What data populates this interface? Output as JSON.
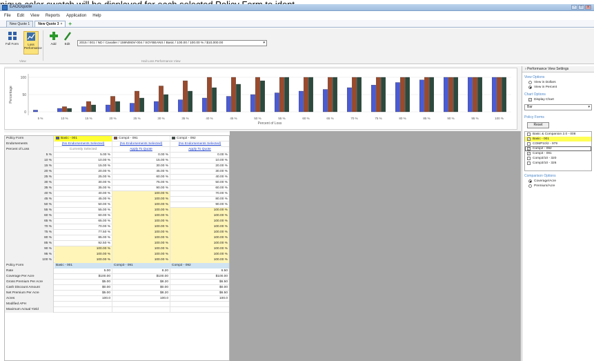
{
  "caption_text": "nique color swatch will be displayed for each selected Policy Form to ident",
  "window": {
    "title": "EAOOquote",
    "buttons": [
      "-",
      "□",
      "x"
    ]
  },
  "menu": [
    "File",
    "Edit",
    "View",
    "Reports",
    "Application",
    "Help"
  ],
  "tabs": [
    {
      "label": "New Quote 1",
      "active": false
    },
    {
      "label": "New Quote 3",
      "active": true,
      "close": "×"
    }
  ],
  "tab_add": "+",
  "ribbon": {
    "full_form": "Full Form",
    "loss_performance": "Loss Performance",
    "view_group": "View",
    "add": "Add",
    "edit": "Edit",
    "combo_value": "2015 / 001 / ND / Cavalier / 159N060r/-004 / SOYBEANS / Basic / 100.00 / 100.00 % / $10,000.00",
    "hail_group": "Hail Loss Performance View"
  },
  "chart_data": {
    "type": "bar",
    "categories": [
      "5 %",
      "10 %",
      "15 %",
      "20 %",
      "25 %",
      "30 %",
      "35 %",
      "40 %",
      "45 %",
      "50 %",
      "55 %",
      "60 %",
      "65 %",
      "70 %",
      "75 %",
      "80 %",
      "85 %",
      "90 %",
      "95 %",
      "100 %"
    ],
    "series": [
      {
        "name": "Basic - 001",
        "color": "#4a5bd6",
        "values": [
          5,
          10,
          15,
          20,
          25,
          30,
          35,
          40,
          45,
          50,
          55,
          60,
          65,
          70,
          77.5,
          85,
          92.5,
          100,
          100,
          100
        ]
      },
      {
        "name": "Comp3 - 091",
        "color": "#9b4a2c",
        "values": [
          0,
          15,
          30,
          45,
          60,
          75,
          90,
          100,
          100,
          100,
          100,
          100,
          100,
          100,
          100,
          100,
          100,
          100,
          100,
          100
        ]
      },
      {
        "name": "Comp2 - 092",
        "color": "#2c4a3e",
        "values": [
          0,
          10,
          20,
          30,
          40,
          50,
          60,
          70,
          80,
          90,
          100,
          100,
          100,
          100,
          100,
          100,
          100,
          100,
          100,
          100
        ]
      }
    ],
    "ylabel": "Percentage",
    "xlabel": "Percent of Loss",
    "yticks": [
      "0",
      "50",
      "100"
    ],
    "ylim": [
      -10,
      110
    ],
    "grid": true,
    "legend": "none"
  },
  "right_panel": {
    "header": "Performance View Settings",
    "view_options": "View Options",
    "view_dollars": "View in Dollars",
    "view_percent": "View in Percent",
    "chart_options": "Chart Options",
    "display_chart": "Display Chart",
    "chart_type": "Bar",
    "policy_forms": "Policy Forms",
    "reset": "Reset",
    "forms": [
      {
        "label": "Basic & Companion 2.0 - 008",
        "checked": false,
        "hl": false
      },
      {
        "label": "Basic - 001",
        "checked": true,
        "hl": true
      },
      {
        "label": "COMP10/2 - 979",
        "checked": false,
        "hl": false
      },
      {
        "label": "Comp2 - 092",
        "checked": true,
        "hl": false,
        "box": true
      },
      {
        "label": "Comp3 - 091",
        "checked": true,
        "hl": false
      },
      {
        "label": "Comp3/10 - 320",
        "checked": false,
        "hl": false
      },
      {
        "label": "Comp3/10 - 326",
        "checked": false,
        "hl": false
      }
    ],
    "comparison_options": "Comparison Options",
    "coverage_acre": "Coverage/Acre",
    "premium_acre": "Premium/Acre"
  },
  "grid": {
    "policy_form_label": "Policy Form",
    "endorsements_label": "Endorsements",
    "percent_loss_label": "Percent of Loss",
    "forms": [
      "Basic - 001",
      "Comp3 - 091",
      "Comp2 - 092"
    ],
    "form_colors": [
      "#4a5bd6",
      "#9b4a2c",
      "#2c4a3e"
    ],
    "endorsements": [
      "(No Endorsements Selected)",
      "(No Endorsements Selected)",
      "(No Endorsements Selected)"
    ],
    "actions": [
      "Currently Selected",
      "Apply To Quote",
      "Apply To Quote"
    ],
    "rows": [
      [
        "5 %",
        "5.00 %",
        "0.00 %",
        "0.00 %"
      ],
      [
        "10 %",
        "10.00 %",
        "15.00 %",
        "10.00 %"
      ],
      [
        "15 %",
        "15.00 %",
        "30.00 %",
        "20.00 %"
      ],
      [
        "20 %",
        "20.00 %",
        "45.00 %",
        "30.00 %"
      ],
      [
        "25 %",
        "25.00 %",
        "60.00 %",
        "40.00 %"
      ],
      [
        "30 %",
        "30.00 %",
        "75.00 %",
        "50.00 %"
      ],
      [
        "35 %",
        "35.00 %",
        "90.00 %",
        "60.00 %"
      ],
      [
        "40 %",
        "40.00 %",
        "100.00 %",
        "70.00 %"
      ],
      [
        "45 %",
        "45.00 %",
        "100.00 %",
        "80.00 %"
      ],
      [
        "50 %",
        "50.00 %",
        "100.00 %",
        "90.00 %"
      ],
      [
        "55 %",
        "55.00 %",
        "100.00 %",
        "100.00 %"
      ],
      [
        "60 %",
        "60.00 %",
        "100.00 %",
        "100.00 %"
      ],
      [
        "65 %",
        "65.00 %",
        "100.00 %",
        "100.00 %"
      ],
      [
        "70 %",
        "70.00 %",
        "100.00 %",
        "100.00 %"
      ],
      [
        "75 %",
        "77.50 %",
        "100.00 %",
        "100.00 %"
      ],
      [
        "80 %",
        "85.00 %",
        "100.00 %",
        "100.00 %"
      ],
      [
        "85 %",
        "92.50 %",
        "100.00 %",
        "100.00 %"
      ],
      [
        "90 %",
        "100.00 %",
        "100.00 %",
        "100.00 %"
      ],
      [
        "95 %",
        "100.00 %",
        "100.00 %",
        "100.00 %"
      ],
      [
        "100 %",
        "100.00 %",
        "100.00 %",
        "100.00 %"
      ]
    ],
    "highlight": [
      [
        false,
        false,
        false
      ],
      [
        false,
        false,
        false
      ],
      [
        false,
        false,
        false
      ],
      [
        false,
        false,
        false
      ],
      [
        false,
        false,
        false
      ],
      [
        false,
        false,
        false
      ],
      [
        false,
        false,
        false
      ],
      [
        false,
        true,
        false
      ],
      [
        false,
        true,
        false
      ],
      [
        false,
        true,
        false
      ],
      [
        false,
        true,
        true
      ],
      [
        false,
        true,
        true
      ],
      [
        false,
        true,
        true
      ],
      [
        false,
        true,
        true
      ],
      [
        false,
        true,
        true
      ],
      [
        false,
        true,
        true
      ],
      [
        false,
        true,
        true
      ],
      [
        true,
        true,
        true
      ],
      [
        true,
        true,
        true
      ],
      [
        true,
        true,
        true
      ]
    ],
    "summary_header": [
      "Policy Form",
      "Basic - 001",
      "Comp3 - 091",
      "Comp2 - 092"
    ],
    "summary_rows": [
      [
        "Rate",
        "5.00",
        "8.20",
        "6.50"
      ],
      [
        "Coverage Per Acre",
        "$100.00",
        "$100.00",
        "$100.00"
      ],
      [
        "Gross Premium Per Acre",
        "$5.00",
        "$8.20",
        "$6.50"
      ],
      [
        "Cash Discount Amount",
        "$0.00",
        "$0.00",
        "$0.00"
      ],
      [
        "Net Premium Per Acre",
        "$5.00",
        "$8.20",
        "$6.50"
      ],
      [
        "Acres",
        "100.0",
        "100.0",
        "100.0"
      ],
      [
        "Modified APH",
        "",
        "",
        ""
      ],
      [
        "Maximum Actual Yield",
        "",
        "",
        ""
      ]
    ]
  }
}
